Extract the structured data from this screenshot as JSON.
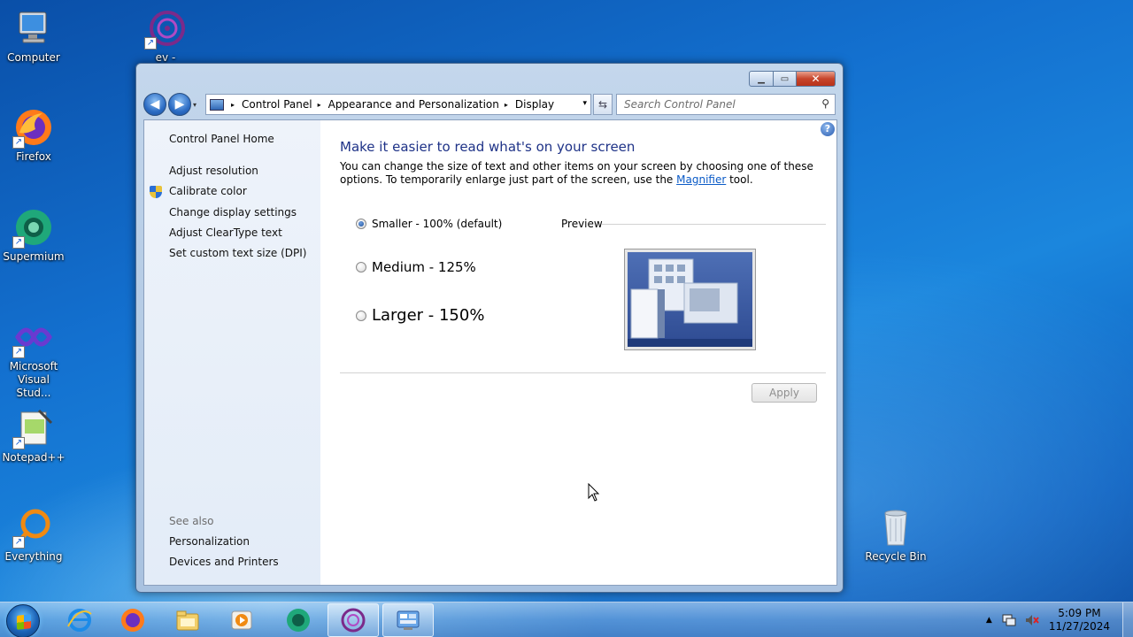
{
  "desktop": {
    "icons": [
      {
        "label": "Computer"
      },
      {
        "label": "ev - Shortcut"
      },
      {
        "label": "Firefox"
      },
      {
        "label": "Supermium"
      },
      {
        "label": "Microsoft Visual Stud..."
      },
      {
        "label": "Notepad++"
      },
      {
        "label": "Everything"
      },
      {
        "label": "Recycle Bin"
      }
    ]
  },
  "window": {
    "controls": {
      "minimize": "▁",
      "maximize": "▭",
      "close": "✕"
    },
    "nav": {
      "back": "◀",
      "forward": "▶",
      "dropdown": "▾"
    },
    "breadcrumb": {
      "items": [
        "Control Panel",
        "Appearance and Personalization",
        "Display"
      ],
      "separator": "▸"
    },
    "refresh": "⇆",
    "search": {
      "placeholder": "Search Control Panel",
      "icon": "⚲"
    },
    "sidebar": {
      "home": "Control Panel Home",
      "links": [
        "Adjust resolution",
        "Calibrate color",
        "Change display settings",
        "Adjust ClearType text",
        "Set custom text size (DPI)"
      ],
      "see_also_label": "See also",
      "see_also": [
        "Personalization",
        "Devices and Printers"
      ]
    },
    "main": {
      "help": "?",
      "heading": "Make it easier to read what's on your screen",
      "desc_before": "You can change the size of text and other items on your screen by choosing one of these options. To temporarily enlarge just part of the screen, use the ",
      "desc_link": "Magnifier",
      "desc_after": " tool.",
      "options": [
        {
          "label": "Smaller - 100% (default)",
          "checked": true
        },
        {
          "label": "Medium - 125%",
          "checked": false
        },
        {
          "label": "Larger - 150%",
          "checked": false
        }
      ],
      "preview_label": "Preview",
      "apply_label": "Apply"
    }
  },
  "taskbar": {
    "clock_time": "5:09 PM",
    "clock_date": "11/27/2024",
    "tray_arrow": "▲",
    "colors": {
      "accent": "#1e3287"
    }
  }
}
